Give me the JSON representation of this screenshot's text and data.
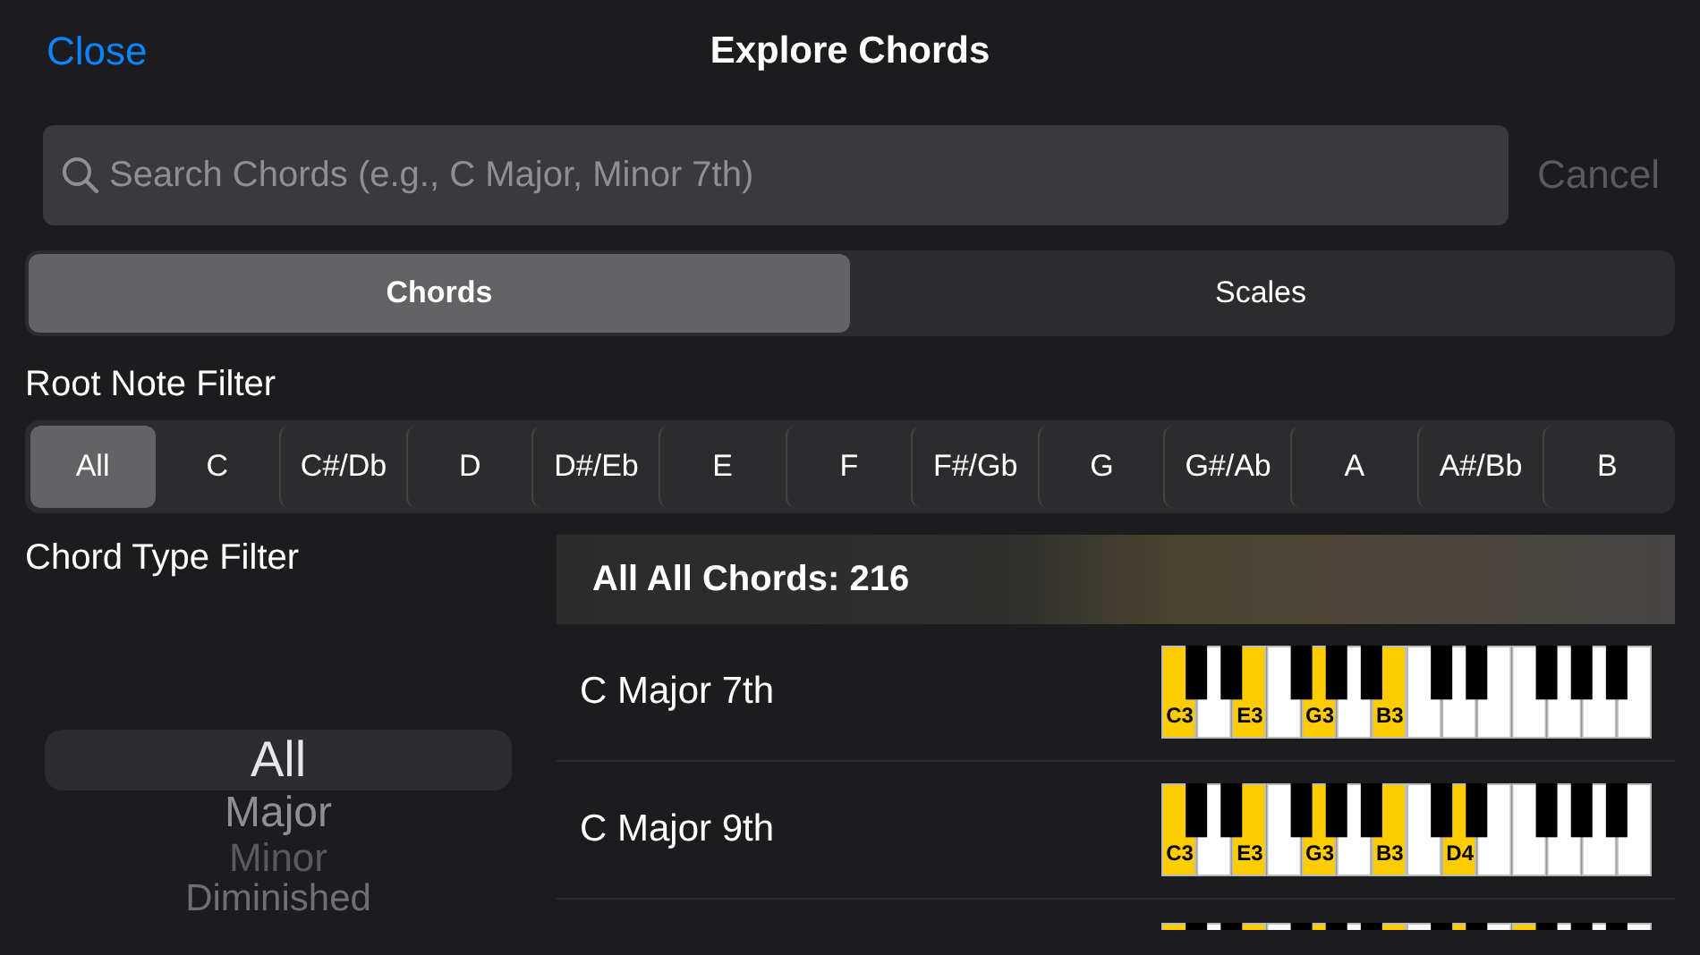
{
  "nav": {
    "close": "Close",
    "title": "Explore Chords"
  },
  "search": {
    "placeholder": "Search Chords (e.g., C Major, Minor 7th)",
    "cancel": "Cancel",
    "cancel_disabled": true
  },
  "mode_tabs": [
    {
      "label": "Chords",
      "selected": true
    },
    {
      "label": "Scales",
      "selected": false
    }
  ],
  "root_filter": {
    "title": "Root Note Filter",
    "options": [
      {
        "label": "All",
        "selected": true
      },
      {
        "label": "C",
        "selected": false
      },
      {
        "label": "C#/Db",
        "selected": false
      },
      {
        "label": "D",
        "selected": false
      },
      {
        "label": "D#/Eb",
        "selected": false
      },
      {
        "label": "E",
        "selected": false
      },
      {
        "label": "F",
        "selected": false
      },
      {
        "label": "F#/Gb",
        "selected": false
      },
      {
        "label": "G",
        "selected": false
      },
      {
        "label": "G#/Ab",
        "selected": false
      },
      {
        "label": "A",
        "selected": false
      },
      {
        "label": "A#/Bb",
        "selected": false
      },
      {
        "label": "B",
        "selected": false
      }
    ]
  },
  "type_filter": {
    "title": "Chord Type Filter",
    "options": [
      {
        "label": "All",
        "selected": true
      },
      {
        "label": "Major",
        "selected": false
      },
      {
        "label": "Minor",
        "selected": false
      },
      {
        "label": "Diminished",
        "selected": false
      }
    ]
  },
  "list": {
    "header": "All All Chords: 216",
    "rows": [
      {
        "name": "C Major 7th",
        "keys": [
          {
            "highlighted": true,
            "label": "C3"
          },
          {
            "highlighted": false
          },
          {
            "highlighted": true,
            "label": "E3"
          },
          {
            "highlighted": false
          },
          {
            "highlighted": true,
            "label": "G3"
          },
          {
            "highlighted": false
          },
          {
            "highlighted": true,
            "label": "B3"
          },
          {
            "highlighted": false
          },
          {
            "highlighted": false
          },
          {
            "highlighted": false
          },
          {
            "highlighted": false
          },
          {
            "highlighted": false
          },
          {
            "highlighted": false
          },
          {
            "highlighted": false
          }
        ]
      },
      {
        "name": "C Major 9th",
        "keys": [
          {
            "highlighted": true,
            "label": "C3"
          },
          {
            "highlighted": false
          },
          {
            "highlighted": true,
            "label": "E3"
          },
          {
            "highlighted": false
          },
          {
            "highlighted": true,
            "label": "G3"
          },
          {
            "highlighted": false
          },
          {
            "highlighted": true,
            "label": "B3"
          },
          {
            "highlighted": false
          },
          {
            "highlighted": true,
            "label": "D4"
          },
          {
            "highlighted": false
          },
          {
            "highlighted": false
          },
          {
            "highlighted": false
          },
          {
            "highlighted": false
          },
          {
            "highlighted": false
          }
        ]
      }
    ],
    "partial_row": {
      "keys": [
        {
          "highlighted": true
        },
        {
          "highlighted": false
        },
        {
          "highlighted": true
        },
        {
          "highlighted": false
        },
        {
          "highlighted": true
        },
        {
          "highlighted": false
        },
        {
          "highlighted": true
        },
        {
          "highlighted": false
        },
        {
          "highlighted": true
        },
        {
          "highlighted": false
        },
        {
          "highlighted": true
        },
        {
          "highlighted": false
        },
        {
          "highlighted": false
        },
        {
          "highlighted": false
        }
      ]
    }
  }
}
